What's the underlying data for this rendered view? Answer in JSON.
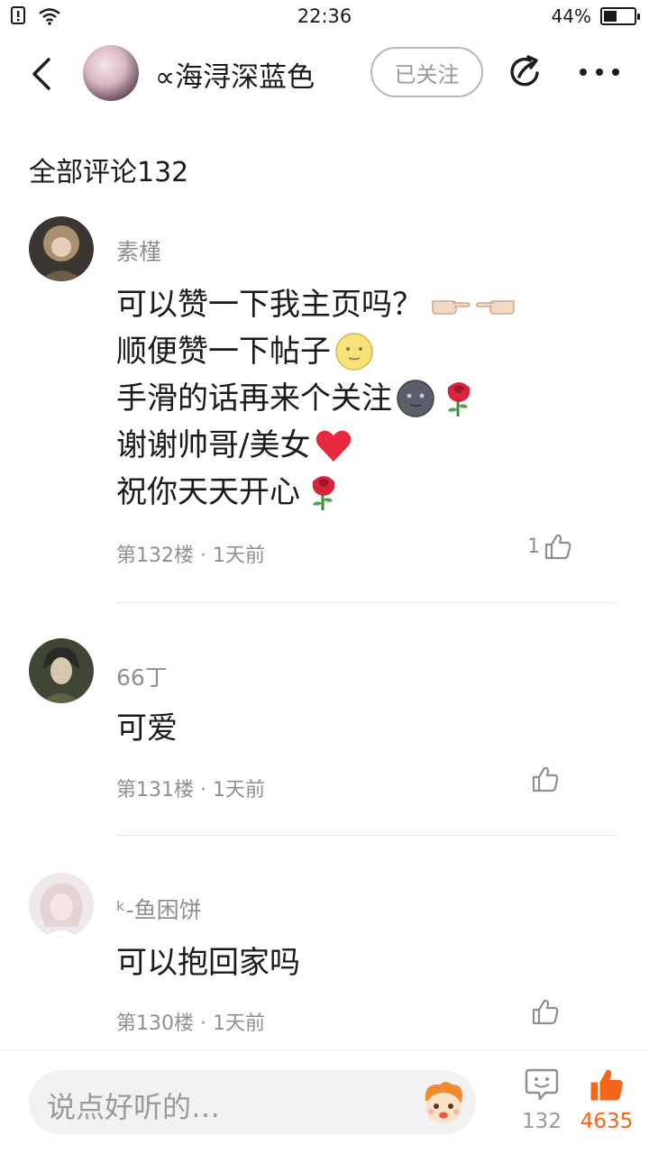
{
  "status_bar": {
    "time": "22:36",
    "battery_percent": "44%",
    "battery_level": 0.44
  },
  "nav": {
    "title": "∝海浔深蓝色",
    "follow_label": "已关注"
  },
  "section": {
    "title": "全部评论132"
  },
  "comments": [
    {
      "username": "素槿",
      "lines": [
        "可以赞一下我主页吗？",
        "顺便赞一下帖子",
        "手滑的话再来个关注",
        "谢谢帅哥/美女",
        "祝你天天开心"
      ],
      "meta": "第132楼 · 1天前",
      "likes": "1"
    },
    {
      "username": "66丁",
      "lines": [
        "可爱"
      ],
      "meta": "第131楼 · 1天前",
      "likes": ""
    },
    {
      "username": "ᵏ-鱼困饼",
      "lines": [
        "可以抱回家吗"
      ],
      "meta": "第130楼 · 1天前",
      "likes": ""
    }
  ],
  "bottom_bar": {
    "input_placeholder": "说点好听的…",
    "comment_count": "132",
    "like_count": "4635",
    "accent_color": "#f5661a"
  }
}
